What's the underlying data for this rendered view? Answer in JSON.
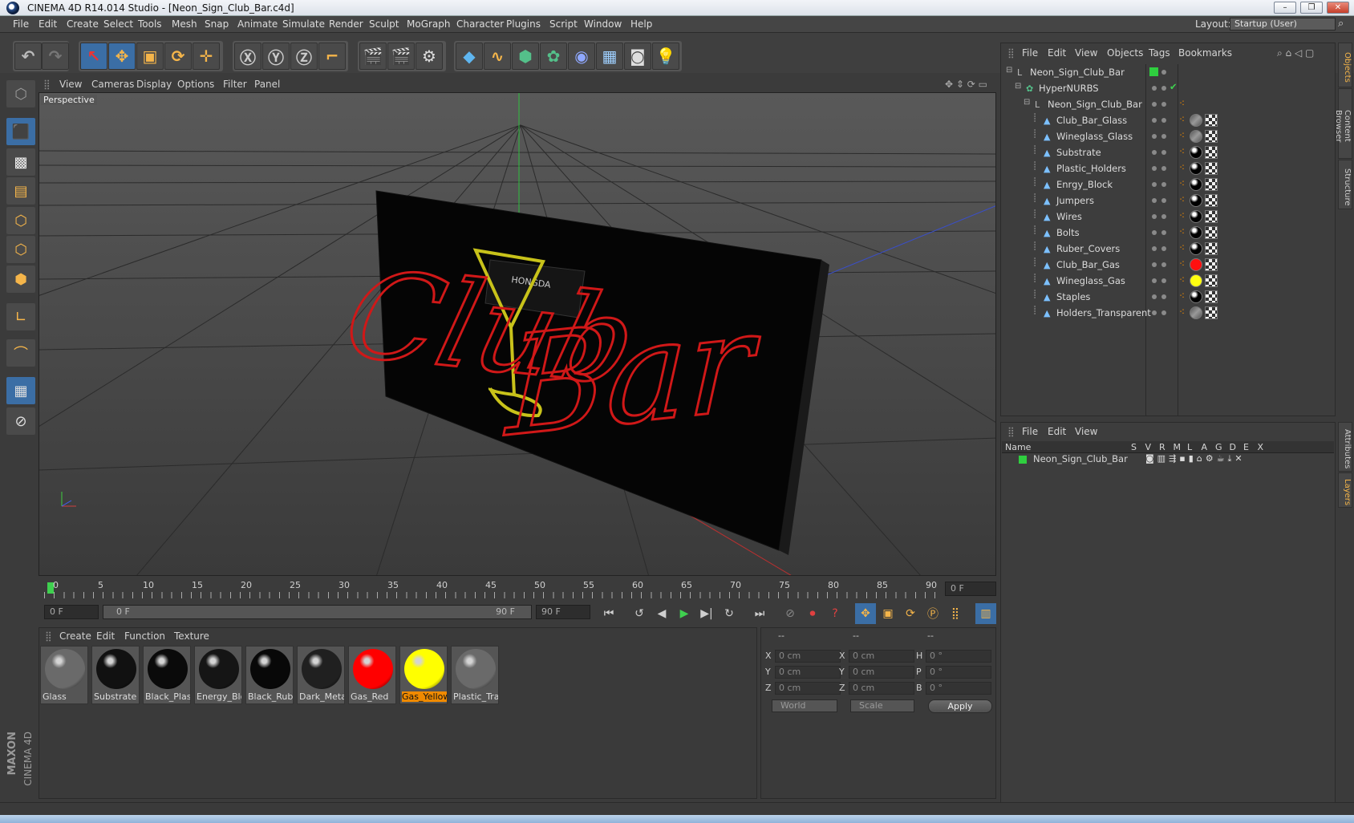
{
  "window": {
    "title": "CINEMA 4D R14.014 Studio - [Neon_Sign_Club_Bar.c4d]",
    "min": "–",
    "max": "❐",
    "close": "✕"
  },
  "menu": [
    "File",
    "Edit",
    "Create",
    "Select",
    "Tools",
    "Mesh",
    "Snap",
    "Animate",
    "Simulate",
    "Render",
    "Sculpt",
    "MoGraph",
    "Character",
    "Plugins",
    "Script",
    "Window",
    "Help"
  ],
  "layout": {
    "label": "Layout:",
    "value": "Startup (User)"
  },
  "viewport": {
    "menu": [
      "View",
      "Cameras",
      "Display",
      "Options",
      "Filter",
      "Panel"
    ],
    "label": "Perspective",
    "sign_word1": "Club",
    "sign_word2": "Bar",
    "brand_label": "HONGDA"
  },
  "timeline": {
    "ticks": [
      "0",
      "5",
      "10",
      "15",
      "20",
      "25",
      "30",
      "35",
      "40",
      "45",
      "50",
      "55",
      "60",
      "65",
      "70",
      "75",
      "80",
      "85",
      "90"
    ],
    "current_frame": "0 F",
    "start": "0 F",
    "range_start": "0 F",
    "range_end": "90 F",
    "end": "90 F"
  },
  "materials": {
    "menu": [
      "Create",
      "Edit",
      "Function",
      "Texture"
    ],
    "items": [
      {
        "name": "Glass",
        "color": "#6a6a6a"
      },
      {
        "name": "Substrate",
        "color": "#111111"
      },
      {
        "name": "Black_Plast",
        "color": "#0a0a0a"
      },
      {
        "name": "Energy_Blo",
        "color": "#151515"
      },
      {
        "name": "Black_Rubl",
        "color": "#080808"
      },
      {
        "name": "Dark_Meta",
        "color": "#202020"
      },
      {
        "name": "Gas_Red",
        "color": "#ff0000"
      },
      {
        "name": "Gas_Yellow",
        "color": "#ffff00"
      },
      {
        "name": "Plastic_Trar",
        "color": "#6a6a6a"
      }
    ]
  },
  "coords": {
    "header": [
      "--",
      "--",
      "--"
    ],
    "rows": [
      {
        "a": "X",
        "av": "0 cm",
        "b": "X",
        "bv": "0 cm",
        "c": "H",
        "cv": "0 °"
      },
      {
        "a": "Y",
        "av": "0 cm",
        "b": "Y",
        "bv": "0 cm",
        "c": "P",
        "cv": "0 °"
      },
      {
        "a": "Z",
        "av": "0 cm",
        "b": "Z",
        "bv": "0 cm",
        "c": "B",
        "cv": "0 °"
      }
    ],
    "mode": "World",
    "scale": "Scale",
    "apply": "Apply"
  },
  "objects": {
    "menu": [
      "File",
      "Edit",
      "View",
      "Objects",
      "Tags",
      "Bookmarks"
    ],
    "rows": [
      {
        "name": "Neon_Sign_Club_Bar",
        "indent": 0,
        "tag": "green"
      },
      {
        "name": "HyperNURBS",
        "indent": 1,
        "tag": "check"
      },
      {
        "name": "Neon_Sign_Club_Bar",
        "indent": 2,
        "tag": "none"
      },
      {
        "name": "Club_Bar_Glass",
        "indent": 3,
        "tag": "glass"
      },
      {
        "name": "Wineglass_Glass",
        "indent": 3,
        "tag": "glass"
      },
      {
        "name": "Substrate",
        "indent": 3,
        "tag": "black"
      },
      {
        "name": "Plastic_Holders",
        "indent": 3,
        "tag": "black"
      },
      {
        "name": "Enrgy_Block",
        "indent": 3,
        "tag": "black"
      },
      {
        "name": "Jumpers",
        "indent": 3,
        "tag": "black"
      },
      {
        "name": "Wires",
        "indent": 3,
        "tag": "black"
      },
      {
        "name": "Bolts",
        "indent": 3,
        "tag": "black"
      },
      {
        "name": "Ruber_Covers",
        "indent": 3,
        "tag": "black"
      },
      {
        "name": "Club_Bar_Gas",
        "indent": 3,
        "tag": "red"
      },
      {
        "name": "Wineglass_Gas",
        "indent": 3,
        "tag": "yellow"
      },
      {
        "name": "Staples",
        "indent": 3,
        "tag": "black"
      },
      {
        "name": "Holders_Transparent",
        "indent": 3,
        "tag": "glass"
      }
    ]
  },
  "layers": {
    "menu": [
      "File",
      "Edit",
      "View"
    ],
    "columns": [
      "Name",
      "S",
      "V",
      "R",
      "M",
      "L",
      "A",
      "G",
      "D",
      "E",
      "X"
    ],
    "row": "Neon_Sign_Club_Bar"
  },
  "side_tabs": [
    "Objects",
    "Content Browser",
    "Structure",
    "Attributes",
    "Layers"
  ],
  "brand": {
    "line1": "MAXON",
    "line2": "CINEMA 4D"
  }
}
